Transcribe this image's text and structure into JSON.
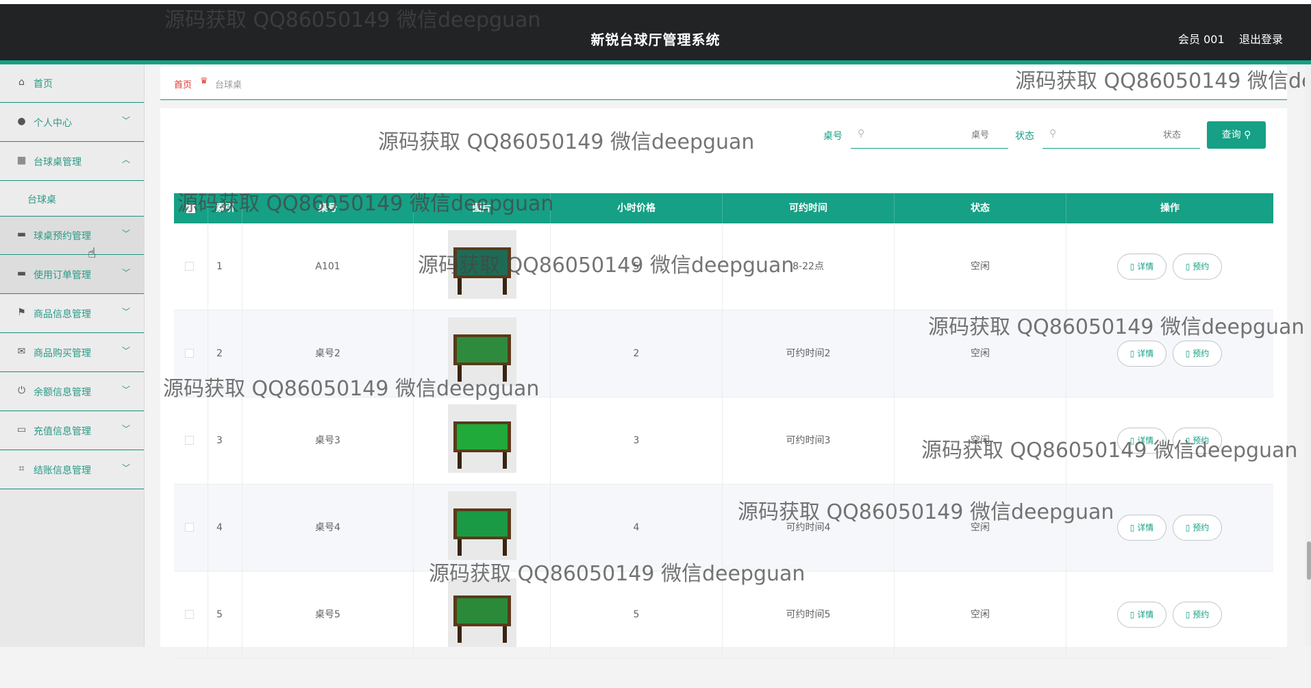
{
  "header": {
    "title": "新锐台球厅管理系统",
    "user": "会员 001",
    "logout": "退出登录"
  },
  "sidebar": {
    "items": [
      {
        "label": "首页",
        "icon": "home-icon"
      },
      {
        "label": "个人中心",
        "icon": "user-icon"
      },
      {
        "label": "台球桌管理",
        "icon": "grid-icon",
        "expanded": true
      },
      {
        "label": "台球桌",
        "sub": true
      },
      {
        "label": "球桌预约管理",
        "icon": "table-icon"
      },
      {
        "label": "使用订单管理",
        "icon": "order-icon"
      },
      {
        "label": "商品信息管理",
        "icon": "flag-icon"
      },
      {
        "label": "商品购买管理",
        "icon": "mail-icon"
      },
      {
        "label": "余额信息管理",
        "icon": "power-icon"
      },
      {
        "label": "充值信息管理",
        "icon": "chat-icon"
      },
      {
        "label": "结账信息管理",
        "icon": "crop-icon"
      }
    ]
  },
  "breadcrumb": {
    "home": "首页",
    "current": "台球桌"
  },
  "search": {
    "table_no_label": "桌号",
    "table_no_placeholder": "桌号",
    "status_label": "状态",
    "status_placeholder": "状态",
    "button": "查询"
  },
  "table": {
    "headers": [
      "索引",
      "桌号",
      "图片",
      "小时价格",
      "可约时间",
      "状态",
      "操作"
    ],
    "rows": [
      {
        "index": "1",
        "table_no": "A101",
        "price": "5",
        "time": "8-22点",
        "status": "空闲",
        "detail": "详情",
        "reserve": "预约"
      },
      {
        "index": "2",
        "table_no": "桌号2",
        "price": "2",
        "time": "可约时间2",
        "status": "空闲",
        "detail": "详情",
        "reserve": "预约"
      },
      {
        "index": "3",
        "table_no": "桌号3",
        "price": "3",
        "time": "可约时间3",
        "status": "空闲",
        "detail": "详情",
        "reserve": "预约"
      },
      {
        "index": "4",
        "table_no": "桌号4",
        "price": "4",
        "time": "可约时间4",
        "status": "空闲",
        "detail": "详情",
        "reserve": "预约"
      },
      {
        "index": "5",
        "table_no": "桌号5",
        "price": "5",
        "time": "可约时间5",
        "status": "空闲",
        "detail": "详情",
        "reserve": "预约"
      }
    ]
  },
  "watermark": "源码获取 QQ86050149 微信deepguan",
  "colors": {
    "accent": "#16a085",
    "header_bg": "#222325"
  }
}
